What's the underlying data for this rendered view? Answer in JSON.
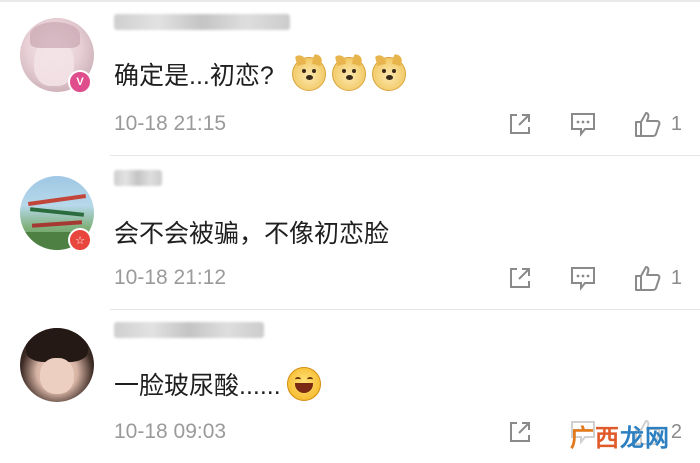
{
  "comments": [
    {
      "text": "确定是...初恋?",
      "time": "10-18 21:15",
      "likes": "1",
      "emoji": [
        "dog-emoji",
        "dog-emoji",
        "dog-emoji"
      ],
      "badge": "V",
      "badge_color": "#e04d8c"
    },
    {
      "text": "会不会被骗，不像初恋脸",
      "time": "10-18 21:12",
      "likes": "1",
      "badge": "☆",
      "badge_color": "#e8453c"
    },
    {
      "text": "一脸玻尿酸......",
      "time": "10-18 09:03",
      "likes": "2",
      "emoji": [
        "laughing-emoji"
      ]
    }
  ],
  "watermark": {
    "part1": "广",
    "part2": "西",
    "part3": "龙网"
  }
}
